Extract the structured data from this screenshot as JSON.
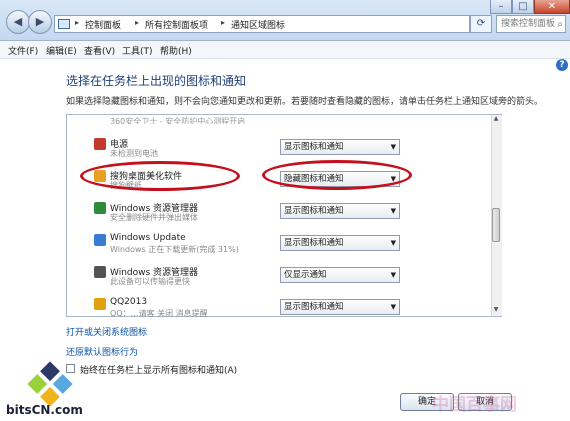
{
  "window": {
    "minimize_glyph": "–",
    "maximize_glyph": "□",
    "close_glyph": "✕"
  },
  "address_bar": {
    "breadcrumbs": [
      "控制面板",
      "所有控制面板项",
      "通知区域图标"
    ],
    "separator": "▸",
    "search_placeholder": "搜索控制面板"
  },
  "menu": [
    "文件(F)",
    "编辑(E)",
    "查看(V)",
    "工具(T)",
    "帮助(H)"
  ],
  "page": {
    "title": "选择在任务栏上出现的图标和通知",
    "description": "如果选择隐藏图标和通知，则不会向您通知更改和更新。若要随时查看隐藏的图标，请单击任务栏上通知区域旁的箭头。"
  },
  "list": {
    "cut_top_text": "360安全卫士 - 安全防护中心测程开启",
    "rows": [
      {
        "name": "电源",
        "sub": "未检测到电池",
        "behavior": "显示图标和通知",
        "icon": "power-icon",
        "color": "#c23a2c"
      },
      {
        "name": "搜狗桌面美化软件",
        "sub": "搜狗壁纸",
        "behavior": "隐藏图标和通知",
        "icon": "sogou-icon",
        "color": "#e8a020"
      },
      {
        "name": "Windows 资源管理器",
        "sub": "安全删除硬件并弹出媒体",
        "behavior": "显示图标和通知",
        "icon": "usb-safe-remove-icon",
        "color": "#2e8b3a"
      },
      {
        "name": "Windows Update",
        "sub": "Windows 正在下载更新(完成 31%)",
        "behavior": "显示图标和通知",
        "icon": "windows-update-icon",
        "color": "#3a7bd5"
      },
      {
        "name": "Windows 资源管理器",
        "sub": "此设备可以传输得更快",
        "behavior": "仅显示通知",
        "icon": "usb-icon",
        "color": "#555555"
      },
      {
        "name": "QQ2013",
        "sub": "QQ：…请客 关闭 消息提醒",
        "behavior": "显示图标和通知",
        "icon": "qq-icon",
        "color": "#e0a010"
      }
    ]
  },
  "links": {
    "toggle_system_icons": "打开或关闭系统图标",
    "restore_defaults": "还原默认图标行为"
  },
  "checkbox": {
    "label": "始终在任务栏上显示所有图标和通知(A)",
    "checked": false
  },
  "buttons": {
    "ok": "确定",
    "cancel": "取消"
  },
  "overlay": {
    "logo_text": "bitsCN.com",
    "watermark_text": "中国百事网",
    "highlight_color": "#c4101d"
  }
}
